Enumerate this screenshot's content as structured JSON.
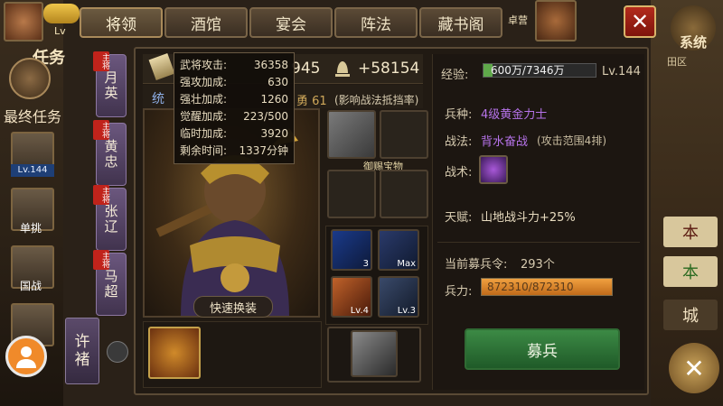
{
  "tabs": [
    "将领",
    "酒馆",
    "宴会",
    "阵法",
    "藏书阁"
  ],
  "top_right": {
    "camp_label": "卓营",
    "system_label": "系统",
    "region_label": "田区"
  },
  "left_hud": {
    "level_prefix": "Lv",
    "quest_label": "任务",
    "final_quest": "最终任务",
    "hero_level": "Lv.144",
    "hero_names": [
      "单挑",
      "国战"
    ],
    "role_badge": "主将"
  },
  "stats_top": {
    "power_partial": "945",
    "power_bonus": "+58154"
  },
  "sub_row": {
    "tong_label": "统",
    "yong_label": "勇 61",
    "note": "(影响战法抵挡率)"
  },
  "tooltip": {
    "rows": [
      {
        "label": "武将攻击:",
        "value": "36358"
      },
      {
        "label": "强攻加成:",
        "value": "630"
      },
      {
        "label": "强壮加成:",
        "value": "1260"
      },
      {
        "label": "觉醒加成:",
        "value": "223/500"
      },
      {
        "label": "临时加成:",
        "value": "3920"
      },
      {
        "label": "剩余时间:",
        "value": "1337分钟"
      }
    ]
  },
  "hero_tabs": [
    {
      "name_top": "月",
      "name_bottom": "英",
      "badge": "主将"
    },
    {
      "name_top": "黄",
      "name_bottom": "忠",
      "badge": "主将"
    },
    {
      "name_top": "张",
      "name_bottom": "辽",
      "badge": "主将"
    },
    {
      "name_top": "马",
      "name_bottom": "超",
      "badge": "主将"
    }
  ],
  "selected_hero": {
    "name_top": "许",
    "name_bottom": "褚"
  },
  "quick_swap_label": "快速换装",
  "treasure_label": "御赐宝物",
  "skill_slots": [
    "3",
    "Max",
    "Lv.4",
    "Lv.3"
  ],
  "skill_prefix": "Lv.",
  "right_panel": {
    "exp_label": "经验:",
    "exp_value": "600万/7346万",
    "exp_fraction": 0.0817,
    "level": "Lv.144",
    "troop_label": "兵种:",
    "troop_value": "4级黄金力士",
    "tactic_label": "战法:",
    "tactic_value": "背水奋战",
    "tactic_note": "(攻击范围4排)",
    "art_label": "战术:",
    "talent_label": "天赋:",
    "talent_value": "山地战斗力+25%",
    "recruit_token_label": "当前募兵令:",
    "recruit_token_value": "293个",
    "force_label": "兵力:",
    "force_value": "872310/872310",
    "force_fraction": 1.0,
    "recruit_button": "募兵"
  },
  "right_edge_buttons": [
    "本",
    "本",
    "城"
  ],
  "close_glyph": "✕",
  "colors": {
    "accent_purple": "#b673ea",
    "recruit_green": "#2f7a3a",
    "close_red": "#b32a1c",
    "force_orange": "#e08a2a",
    "exp_green": "#5fa84a"
  }
}
